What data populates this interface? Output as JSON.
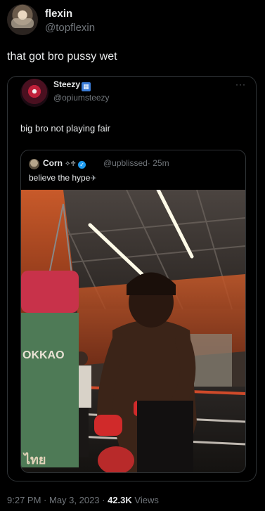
{
  "tweet": {
    "author_name": "flexin",
    "author_handle": "@topflexin",
    "text": "that got bro pussy wet"
  },
  "quoted": {
    "author_name": "Steezy",
    "author_handle": "@opiumsteezy",
    "more": "···",
    "text": "big bro not playing fair",
    "inner": {
      "author_name": "Corn",
      "author_symbols": "✧♱",
      "author_handle": "@upblissed",
      "time": "· 25m",
      "text": "believe the hype",
      "icon": "airplane-icon"
    }
  },
  "footer": {
    "time": "9:27 PM",
    "sep1": " · ",
    "date": "May 3, 2023",
    "sep2": " · ",
    "views_count": "42.3K",
    "views_label": " Views"
  },
  "photo": {
    "bag_text": "OKKAO",
    "bag_text2": "ไทย"
  }
}
